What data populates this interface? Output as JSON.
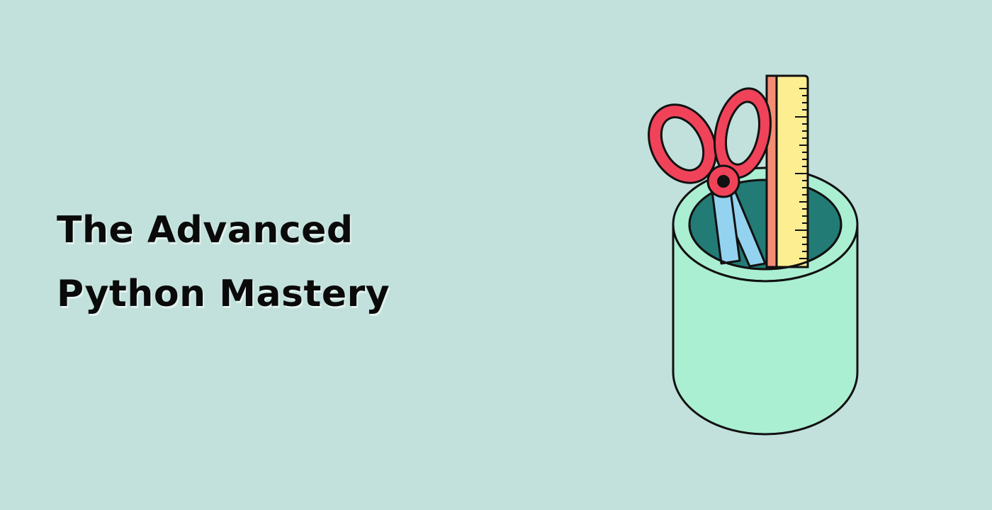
{
  "banner": {
    "title": "The Advanced Python Mastery",
    "illustration_icon": "stationery-cup-icon",
    "colors": {
      "background": "#c2e1dc",
      "title_text": "#0a0a0a",
      "cup_body": "#abefd3",
      "cup_inside": "#237b76",
      "scissors": "#f0435a",
      "compass_legs": "#94d3f0",
      "ruler_face": "#fdee92",
      "ruler_edge": "#f48d73"
    }
  }
}
